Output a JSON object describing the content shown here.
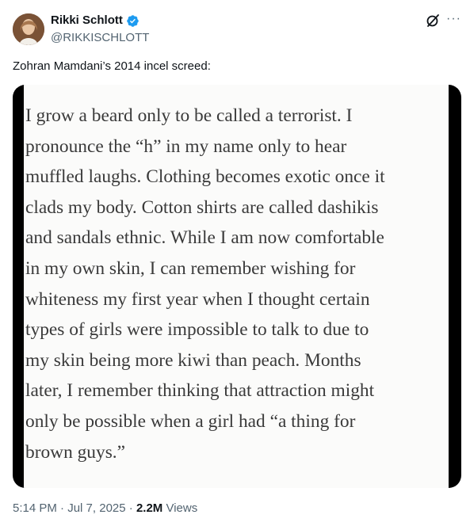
{
  "author": {
    "display_name": "Rikki Schlott",
    "handle": "@RIKKISCHLOTT",
    "verified_icon": "verified-badge-icon",
    "verified_color": "#1d9bf0"
  },
  "header_actions": {
    "grok_icon": "grok-icon",
    "more_icon": "more-horizontal-icon",
    "more_label": "···"
  },
  "tweet": {
    "text": "Zohran Mamdani’s 2014 incel screed:"
  },
  "media": {
    "quote_lines": [
      "I grow a beard only to be called a terrorist. I",
      "pronounce the “h” in my name only to hear",
      "muffled laughs. Clothing becomes exotic once it",
      "clads my body. Cotton shirts are called dashikis",
      "and sandals ethnic. While I am now comfortable",
      "in my own skin, I can remember wishing for",
      "whiteness my first year when I thought certain",
      "types of girls were impossible to talk to due to",
      "my skin being more kiwi than peach. Months",
      "later, I remember thinking that attraction might",
      "only be possible when a girl had “a thing for",
      "brown guys.”"
    ]
  },
  "meta": {
    "time": "5:14 PM",
    "separator": " · ",
    "date": "Jul 7, 2025",
    "views_count": "2.2M",
    "views_label": " Views"
  }
}
